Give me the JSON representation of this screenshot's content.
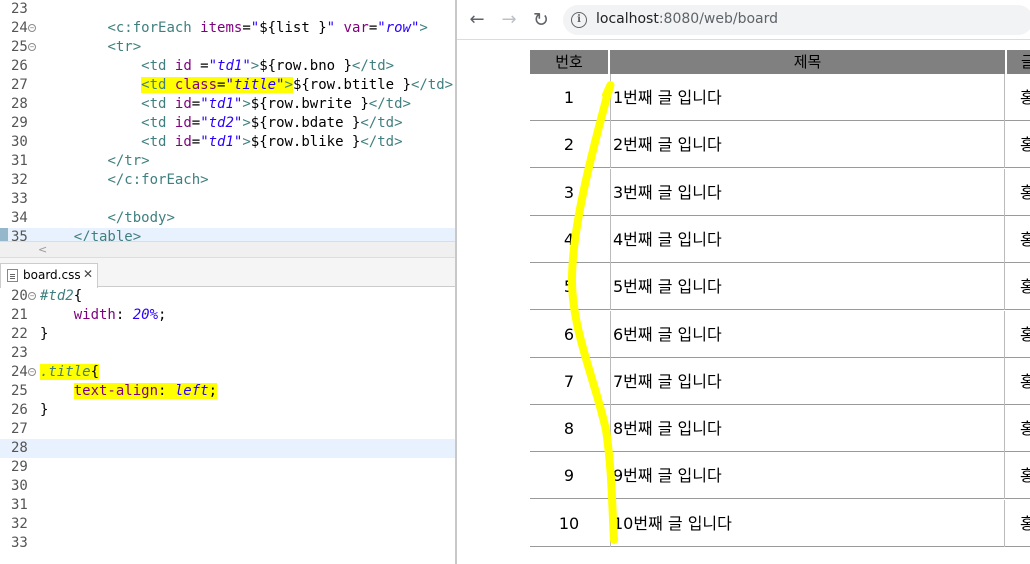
{
  "jsp_editor": {
    "lines": [
      {
        "num": "23",
        "html": ""
      },
      {
        "num": "24",
        "fold": true,
        "html": "        <span class='c-tag'>&lt;c:forEach</span> <span class='c-attr'>items</span>=<span class='c-str'>\"</span>${list }<span class='c-str'>\"</span> <span class='c-attr'>var</span>=<span class='c-str'>\"row\"</span><span class='c-tag'>&gt;</span>"
      },
      {
        "num": "25",
        "fold": true,
        "html": "        <span class='c-tag'>&lt;tr&gt;</span>"
      },
      {
        "num": "26",
        "html": "            <span class='c-tag'>&lt;td</span> <span class='c-attr'>id</span> =<span class='c-str'>\"td1\"</span><span class='c-tag'>&gt;</span>${row.bno }<span class='c-tag'>&lt;/td&gt;</span>"
      },
      {
        "num": "27",
        "html": "            <span class='hl'><span class='c-tag'>&lt;td</span> <span class='c-attr'>class</span>=<span class='c-str'>\"title\"</span><span class='c-tag'>&gt;</span></span>${row.btitle }<span class='c-tag'>&lt;/td&gt;</span>"
      },
      {
        "num": "28",
        "html": "            <span class='c-tag'>&lt;td</span> <span class='c-attr'>id</span>=<span class='c-str'>\"td1\"</span><span class='c-tag'>&gt;</span>${row.bwrite }<span class='c-tag'>&lt;/td&gt;</span>"
      },
      {
        "num": "29",
        "html": "            <span class='c-tag'>&lt;td</span> <span class='c-attr'>id</span>=<span class='c-str'>\"td2\"</span><span class='c-tag'>&gt;</span>${row.bdate }<span class='c-tag'>&lt;/td&gt;</span>"
      },
      {
        "num": "30",
        "html": "            <span class='c-tag'>&lt;td</span> <span class='c-attr'>id</span>=<span class='c-str'>\"td1\"</span><span class='c-tag'>&gt;</span>${row.blike }<span class='c-tag'>&lt;/td&gt;</span>"
      },
      {
        "num": "31",
        "html": "        <span class='c-tag'>&lt;/tr&gt;</span>"
      },
      {
        "num": "32",
        "html": "        <span class='c-tag'>&lt;/c:forEach&gt;</span>"
      },
      {
        "num": "33",
        "html": ""
      },
      {
        "num": "34",
        "html": "        <span class='c-tag'>&lt;/tbody&gt;</span>"
      },
      {
        "num": "35",
        "current": true,
        "marker": true,
        "html": "    <span class='c-tag'>&lt;/table&gt;</span>"
      }
    ]
  },
  "css_tab": {
    "label": "board.css"
  },
  "css_editor": {
    "lines": [
      {
        "num": "20",
        "fold": true,
        "html": "<span class='c-sel'>#td2</span>{"
      },
      {
        "num": "21",
        "html": "    <span class='c-prop'>width</span>: <span class='c-val'>20%</span>;"
      },
      {
        "num": "22",
        "html": "}"
      },
      {
        "num": "23",
        "html": ""
      },
      {
        "num": "24",
        "fold": true,
        "html": "<span class='hl'><span class='c-sel'>.title</span>{</span>"
      },
      {
        "num": "25",
        "html": "    <span class='hl'><span class='c-prop'>text-align</span>: <span class='c-val'>left</span>;</span>"
      },
      {
        "num": "26",
        "html": "}"
      },
      {
        "num": "27",
        "html": ""
      },
      {
        "num": "28",
        "current": true,
        "html": ""
      },
      {
        "num": "29",
        "html": ""
      },
      {
        "num": "30",
        "html": ""
      },
      {
        "num": "31",
        "html": ""
      },
      {
        "num": "32",
        "html": ""
      },
      {
        "num": "33",
        "html": ""
      }
    ]
  },
  "browser": {
    "url_host": "localhost",
    "url_path": ":8080/web/board",
    "info_icon": "i",
    "back_icon": "←",
    "forward_icon": "→",
    "reload_icon": "↻"
  },
  "board": {
    "headers": {
      "no": "번호",
      "title": "제목",
      "writer": "글"
    },
    "rows": [
      {
        "no": "1",
        "title": "1번째 글 입니다",
        "writer": "홍"
      },
      {
        "no": "2",
        "title": "2번째 글 입니다",
        "writer": "홍"
      },
      {
        "no": "3",
        "title": "3번째 글 입니다",
        "writer": "홍"
      },
      {
        "no": "4",
        "title": "4번째 글 입니다",
        "writer": "홍"
      },
      {
        "no": "5",
        "title": "5번째 글 입니다",
        "writer": "홍"
      },
      {
        "no": "6",
        "title": "6번째 글 입니다",
        "writer": "홍"
      },
      {
        "no": "7",
        "title": "7번째 글 입니다",
        "writer": "홍"
      },
      {
        "no": "8",
        "title": "8번째 글 입니다",
        "writer": "홍"
      },
      {
        "no": "9",
        "title": "9번째 글 입니다",
        "writer": "홍"
      },
      {
        "no": "10",
        "title": "10번째 글 입니다",
        "writer": "홍"
      }
    ]
  },
  "colors": {
    "highlight": "#ffff00",
    "header_bg": "#808080",
    "annotation": "#ffff00"
  }
}
